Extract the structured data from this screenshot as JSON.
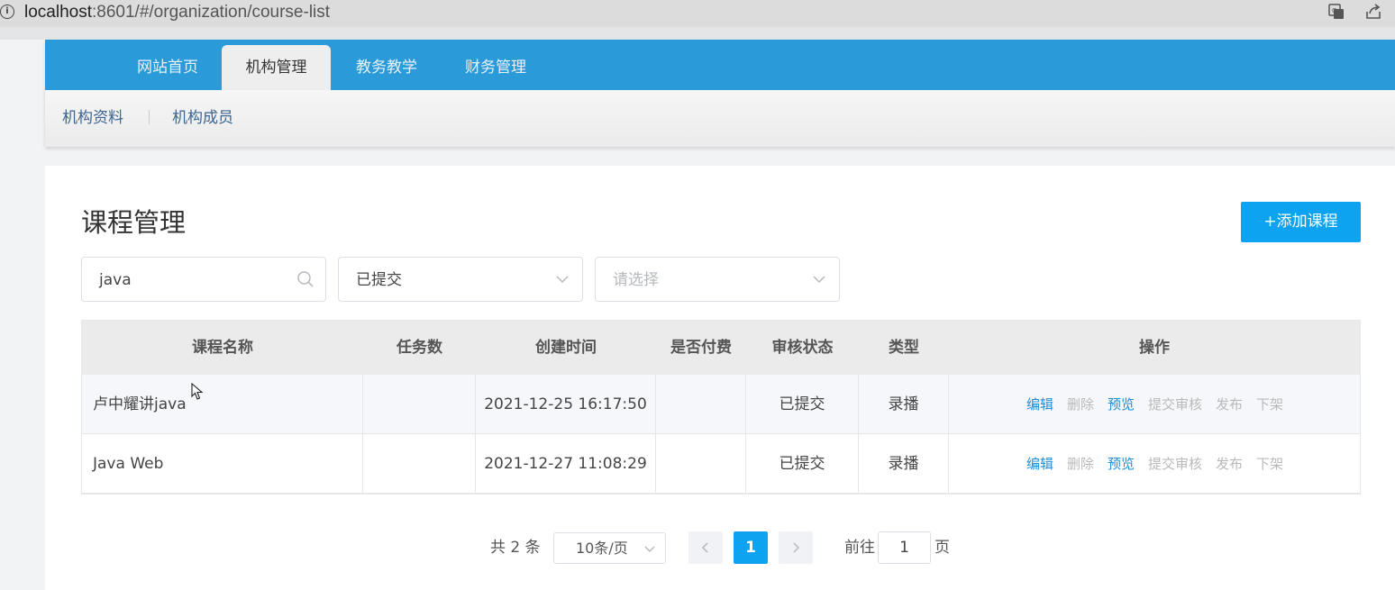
{
  "browser": {
    "url_host": "localhost",
    "url_path": ":8601/#/organization/course-list"
  },
  "nav": {
    "items": [
      {
        "label": "网站首页"
      },
      {
        "label": "机构管理",
        "active": true
      },
      {
        "label": "教务教学"
      },
      {
        "label": "财务管理"
      }
    ]
  },
  "subnav": {
    "items": [
      {
        "label": "机构资料"
      },
      {
        "label": "机构成员"
      }
    ]
  },
  "main": {
    "title": "课程管理",
    "add_button": "+添加课程"
  },
  "filters": {
    "search_value": "java",
    "status_value": "已提交",
    "type_placeholder": "请选择"
  },
  "table": {
    "columns": [
      "课程名称",
      "任务数",
      "创建时间",
      "是否付费",
      "审核状态",
      "类型",
      "操作"
    ],
    "rows": [
      {
        "name": "卢中耀讲java",
        "tasks": "",
        "created": "2021-12-25 16:17:50",
        "paid": "",
        "status": "已提交",
        "type": "录播"
      },
      {
        "name": "Java Web",
        "tasks": "",
        "created": "2021-12-27 11:08:29",
        "paid": "",
        "status": "已提交",
        "type": "录播"
      }
    ],
    "actions": {
      "edit": "编辑",
      "delete": "删除",
      "preview": "预览",
      "submit_review": "提交审核",
      "publish": "发布",
      "unpublish": "下架"
    }
  },
  "pagination": {
    "total_text": "共 2 条",
    "page_size": "10条/页",
    "current_page": "1",
    "goto_label": "前往",
    "goto_value": "1",
    "page_unit": "页"
  },
  "colors": {
    "nav_blue": "#2b9ad8",
    "primary_button": "#0da3f0",
    "link_blue": "#1f8ed8",
    "disabled_gray": "#b9b9b9"
  }
}
